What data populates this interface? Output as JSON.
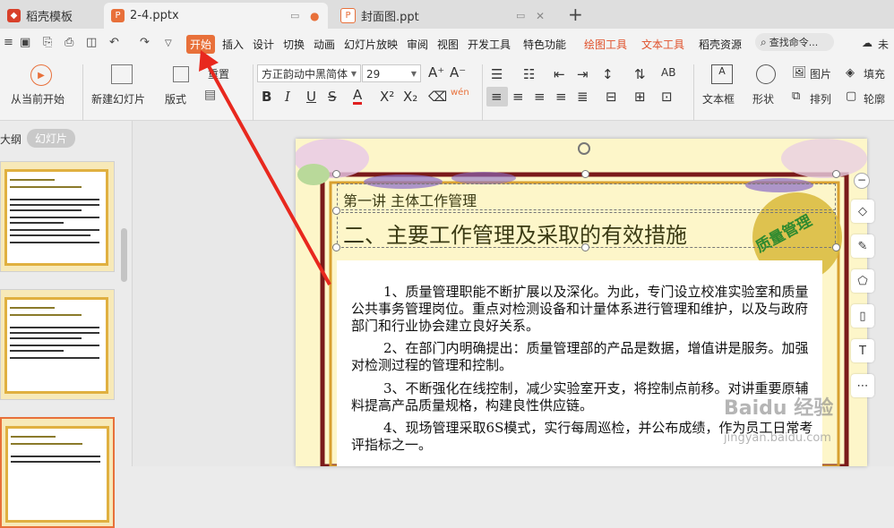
{
  "tabs": [
    {
      "label": "稻壳模板",
      "icon": "docer-icon"
    },
    {
      "label": "2-4.pptx",
      "icon": "pptx-icon",
      "active": true
    },
    {
      "label": "封面图.ppt",
      "icon": "ppt-icon"
    }
  ],
  "new_tab": "+",
  "menu": [
    "开始",
    "插入",
    "设计",
    "切换",
    "动画",
    "幻灯片放映",
    "审阅",
    "视图",
    "开发工具",
    "特色功能",
    "绘图工具",
    "文本工具",
    "稻壳资源"
  ],
  "search_placeholder": "查找命令...",
  "cloud_label": "未",
  "ribbon": {
    "play_label": "从当前开始",
    "new_slide_label": "新建幻灯片",
    "layout_label": "版式",
    "reset_label": "重置",
    "font_name": "方正韵动中黑简体",
    "font_size": "29",
    "textbox_label": "文本框",
    "shape_label": "形状",
    "picture_label": "图片",
    "arrange_label": "排列",
    "fill_label": "填充",
    "outline_label": "轮廓",
    "pinyin": "wén"
  },
  "left": {
    "outline_tab": "大纲",
    "slides_tab": "幻灯片"
  },
  "slide": {
    "subtitle": "第一讲    主体工作管理",
    "title": "二、主要工作管理及采取的有效措施",
    "badge": "质量管理",
    "paragraphs": [
      "1、质量管理职能不断扩展以及深化。为此，专门设立校准实验室和质量公共事务管理岗位。重点对检测设备和计量体系进行管理和维护，以及与政府部门和行业协会建立良好关系。",
      "2、在部门内明确提出：质量管理部的产品是数据，增值讲是服务。加强对检测过程的管理和控制。",
      "3、不断强化在线控制，减少实验室开支，将控制点前移。对讲重要原辅料提高产品质量规格，构建良性供应链。",
      "4、现场管理采取6S模式，实行每周巡检，并公布成绩，作为员工日常考评指标之一。"
    ]
  },
  "watermark": {
    "line1": "Baidu 经验",
    "line2": "jingyan.baidu.com"
  },
  "colors": {
    "accent": "#e8703a",
    "arrow": "#e8281e",
    "slide_border": "#7a1a1a"
  }
}
